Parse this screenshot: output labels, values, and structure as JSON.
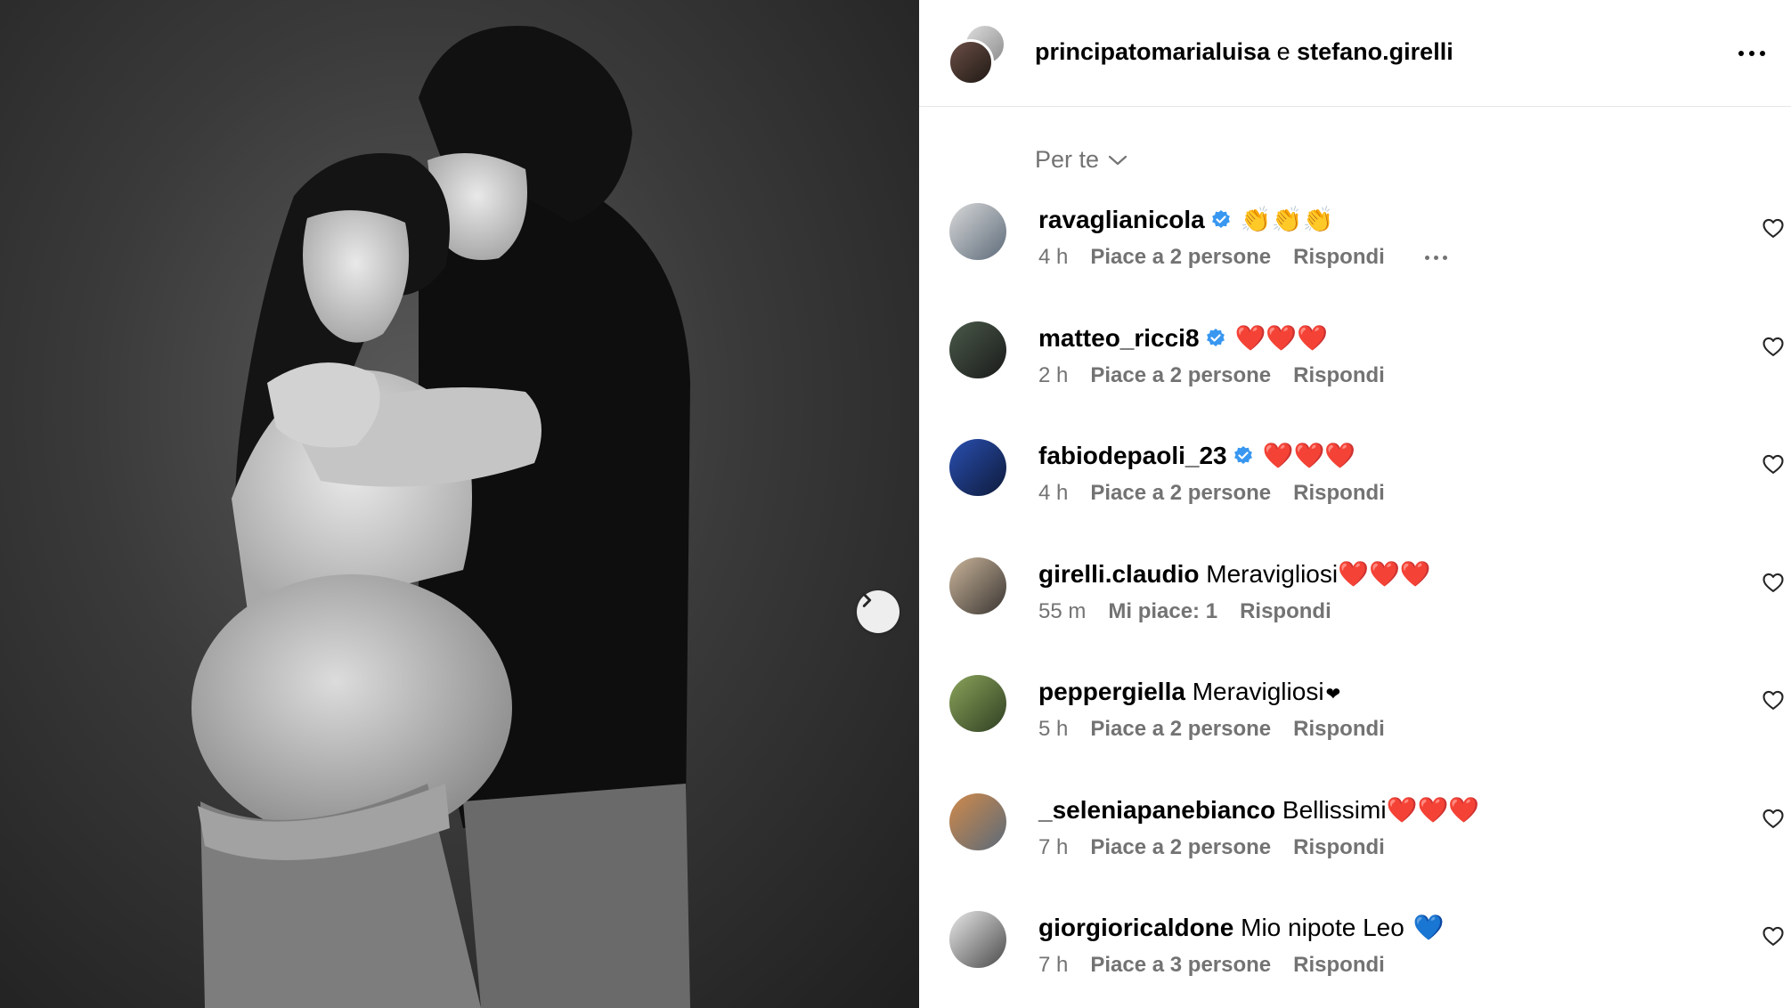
{
  "post": {
    "author_primary": "principatomarialuisa",
    "joiner": "e",
    "author_secondary": "stefano.girelli"
  },
  "sort": {
    "label": "Per te"
  },
  "comments": [
    {
      "username": "ravaglianicola",
      "verified": true,
      "text": "",
      "emoji": "👏👏👏",
      "emoji_kind": "clap",
      "time": "4 h",
      "likes": "Piace a 2 persone",
      "reply": "Rispondi",
      "show_more": true,
      "avatar_colors": [
        "#d9d9d9",
        "#5d6b7a"
      ]
    },
    {
      "username": "matteo_ricci8",
      "verified": true,
      "text": "",
      "emoji": "❤️❤️❤️",
      "emoji_kind": "heart",
      "time": "2 h",
      "likes": "Piace a 2 persone",
      "reply": "Rispondi",
      "show_more": false,
      "avatar_colors": [
        "#4a5a4a",
        "#1a1a1a"
      ]
    },
    {
      "username": "fabiodepaoli_23",
      "verified": true,
      "text": "",
      "emoji": "❤️❤️❤️",
      "emoji_kind": "heart",
      "time": "4 h",
      "likes": "Piace a 2 persone",
      "reply": "Rispondi",
      "show_more": false,
      "avatar_colors": [
        "#2a4fb0",
        "#0d1a3a"
      ]
    },
    {
      "username": "girelli.claudio",
      "verified": false,
      "text": "Meravigliosi",
      "emoji": "❤️❤️❤️",
      "emoji_kind": "heart",
      "time": "55 m",
      "likes": "Mi piace: 1",
      "reply": "Rispondi",
      "show_more": false,
      "avatar_colors": [
        "#c9b49a",
        "#3a3532"
      ]
    },
    {
      "username": "peppergiella",
      "verified": false,
      "text": "Meravigliosi",
      "emoji": "❤",
      "emoji_kind": "small-heart",
      "time": "5 h",
      "likes": "Piace a 2 persone",
      "reply": "Rispondi",
      "show_more": false,
      "avatar_colors": [
        "#8aa35a",
        "#2f3f22"
      ]
    },
    {
      "username": "_seleniapanebianco",
      "verified": false,
      "text": "Bellissimi",
      "emoji": "❤️❤️❤️",
      "emoji_kind": "heart",
      "time": "7 h",
      "likes": "Piace a 2 persone",
      "reply": "Rispondi",
      "show_more": false,
      "avatar_colors": [
        "#d08a4a",
        "#5a6a7a"
      ]
    },
    {
      "username": "giorgioricaldone",
      "verified": false,
      "text": "Mio nipote Leo",
      "emoji": "💙",
      "emoji_kind": "blue",
      "time": "7 h",
      "likes": "Piace a 3 persone",
      "reply": "Rispondi",
      "show_more": false,
      "avatar_colors": [
        "#e8e8e8",
        "#4a4a4a"
      ]
    }
  ],
  "icons": {
    "carousel_next": "chevron-right-icon",
    "more": "more-horizontal-icon",
    "sort": "chevron-down-icon",
    "like": "heart-outline-icon",
    "verified": "verified-badge-icon"
  },
  "colors": {
    "verified": "#3897f0",
    "secondary_text": "#737373",
    "divider": "#e6e6e6"
  }
}
